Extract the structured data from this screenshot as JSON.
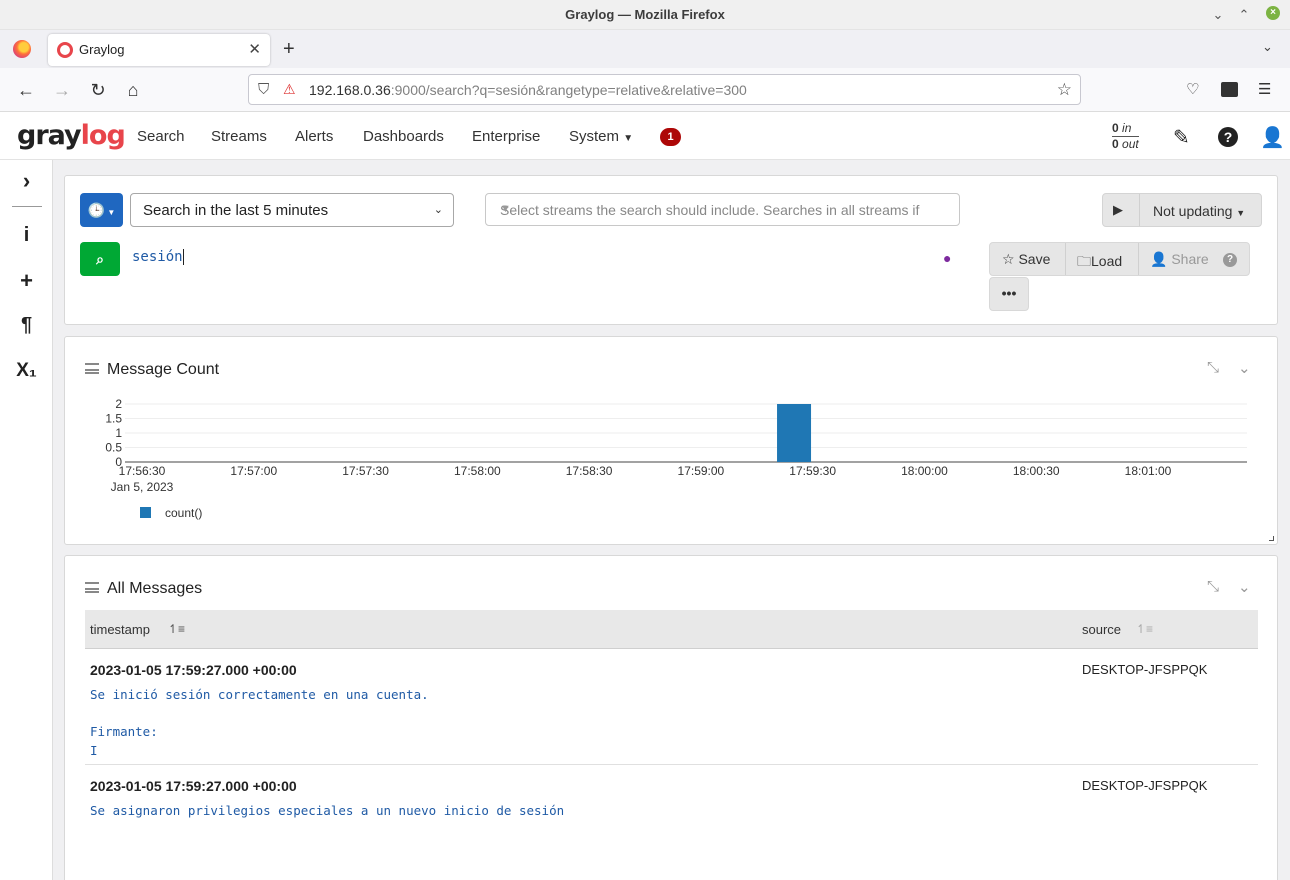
{
  "window": {
    "title": "Graylog — Mozilla Firefox"
  },
  "browser": {
    "tab_title": "Graylog",
    "url_host": "192.168.0.36",
    "url_rest": ":9000/search?q=sesión&rangetype=relative&relative=300"
  },
  "graylog_nav": {
    "items": [
      "Search",
      "Streams",
      "Alerts",
      "Dashboards",
      "Enterprise",
      "System"
    ],
    "notification_count": "1",
    "throughput": {
      "in_value": "0",
      "in_label": "in",
      "out_value": "0",
      "out_label": "out"
    }
  },
  "search": {
    "time_range": "Search in the last 5 minutes",
    "streams_placeholder": "Select streams the search should include. Searches in all streams if empty.",
    "refresh_label": "Not updating",
    "query": "sesión",
    "actions": {
      "save": "Save",
      "load": "Load",
      "share": "Share",
      "more": "•••"
    }
  },
  "message_count_widget": {
    "title": "Message Count"
  },
  "chart_data": {
    "type": "bar",
    "x_ticks": [
      "17:56:30",
      "17:57:00",
      "17:57:30",
      "17:58:00",
      "17:58:30",
      "17:59:00",
      "17:59:30",
      "18:00:00",
      "18:00:30",
      "18:01:00"
    ],
    "x_tick_sublabel": "Jan 5, 2023",
    "y_ticks": [
      "0",
      "0.5",
      "1",
      "1.5",
      "2"
    ],
    "ylim": [
      0,
      2
    ],
    "bars": [
      {
        "x": "17:59:25",
        "value": 2
      }
    ],
    "series": [
      {
        "name": "count()",
        "color": "#1f77b4"
      }
    ],
    "legend_position": "bottom-left",
    "grid": true
  },
  "all_messages_widget": {
    "title": "All Messages",
    "columns": [
      "timestamp",
      "source"
    ],
    "messages": [
      {
        "timestamp": "2023-01-05 17:59:27.000 +00:00",
        "source": "DESKTOP-JFSPPQK",
        "text": "Se inició sesión correctamente en una cuenta.\n\nFirmante:\nI"
      },
      {
        "timestamp": "2023-01-05 17:59:27.000 +00:00",
        "source": "DESKTOP-JFSPPQK",
        "text": "Se asignaron privilegios especiales a un nuevo inicio de sesión"
      }
    ]
  }
}
